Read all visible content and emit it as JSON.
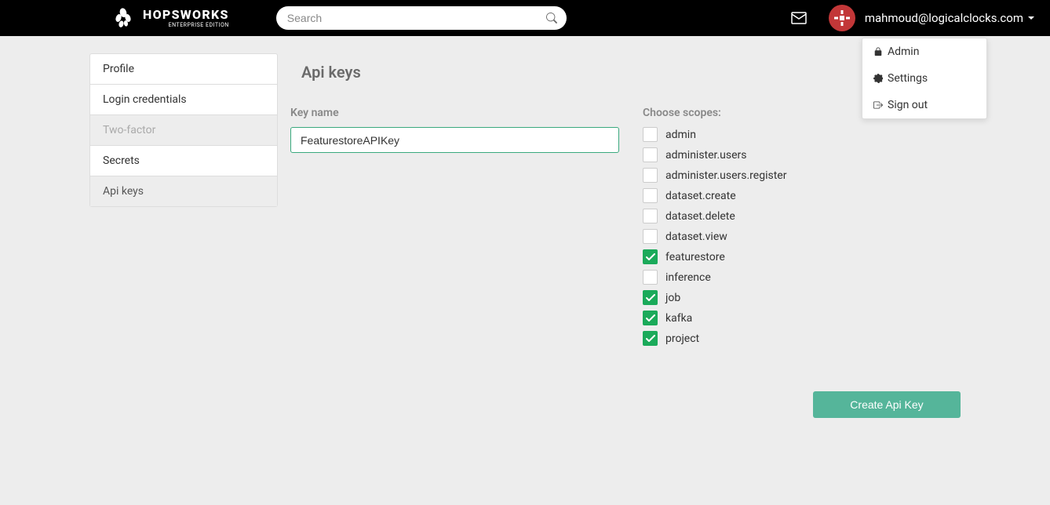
{
  "header": {
    "logo_main": "HOPSWORKS",
    "logo_sub": "ENTERPRISE EDITION",
    "search_placeholder": "Search",
    "user_email": "mahmoud@logicalclocks.com"
  },
  "dropdown": {
    "items": [
      {
        "label": "Admin",
        "icon": "lock"
      },
      {
        "label": "Settings",
        "icon": "gear"
      },
      {
        "label": "Sign out",
        "icon": "signout"
      }
    ]
  },
  "sidebar": {
    "items": [
      {
        "label": "Profile",
        "state": "normal"
      },
      {
        "label": "Login credentials",
        "state": "normal"
      },
      {
        "label": "Two-factor",
        "state": "disabled"
      },
      {
        "label": "Secrets",
        "state": "normal"
      },
      {
        "label": "Api keys",
        "state": "active"
      }
    ]
  },
  "page": {
    "title": "Api keys",
    "key_name_label": "Key name",
    "key_name_value": "FeaturestoreAPIKey",
    "scopes_label": "Choose scopes:",
    "create_button": "Create Api Key"
  },
  "scopes": [
    {
      "label": "admin",
      "checked": false
    },
    {
      "label": "administer.users",
      "checked": false
    },
    {
      "label": "administer.users.register",
      "checked": false
    },
    {
      "label": "dataset.create",
      "checked": false
    },
    {
      "label": "dataset.delete",
      "checked": false
    },
    {
      "label": "dataset.view",
      "checked": false
    },
    {
      "label": "featurestore",
      "checked": true
    },
    {
      "label": "inference",
      "checked": false
    },
    {
      "label": "job",
      "checked": true
    },
    {
      "label": "kafka",
      "checked": true
    },
    {
      "label": "project",
      "checked": true
    }
  ]
}
